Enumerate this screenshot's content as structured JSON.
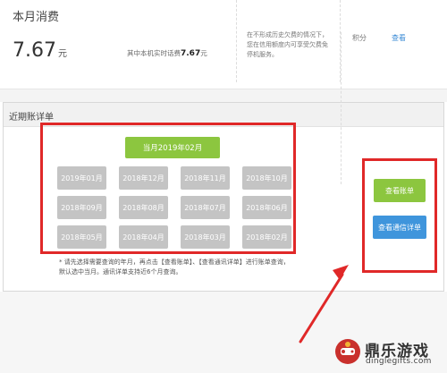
{
  "summary": {
    "title": "本月消费",
    "amount": "7.67",
    "amount_unit": "元",
    "realtime_prefix": "其中本机实时话费",
    "realtime_value": "7.67",
    "realtime_unit": "元",
    "note": "在不形成历史欠费的情况下，您在信用额度内可享受欠费免停机服务。",
    "points_label": "积分",
    "points_link": "查看"
  },
  "bill": {
    "title": "近期账详单",
    "current_month": "当月2019年02月",
    "months": [
      "2019年01月",
      "2018年12月",
      "2018年11月",
      "2018年10月",
      "2018年09月",
      "2018年08月",
      "2018年07月",
      "2018年06月",
      "2018年05月",
      "2018年04月",
      "2018年03月",
      "2018年02月"
    ],
    "hint_line1": "* 请先选择需要查询的年月，再点击【查看账单】、【查看通讯详单】进行账单查询，",
    "hint_line2": "默认选中当月。通讯详单支持近6个月查询。",
    "view_bill": "查看账单",
    "view_call_detail": "查看通信详单"
  },
  "watermark": {
    "title": "鼎乐游戏",
    "url": "dinglegifts.com"
  },
  "colors": {
    "green": "#8cc63f",
    "blue": "#3f95dc",
    "highlight_red": "#e02828",
    "month_gray": "#c4c4c4",
    "link_blue": "#3b8bd6"
  }
}
